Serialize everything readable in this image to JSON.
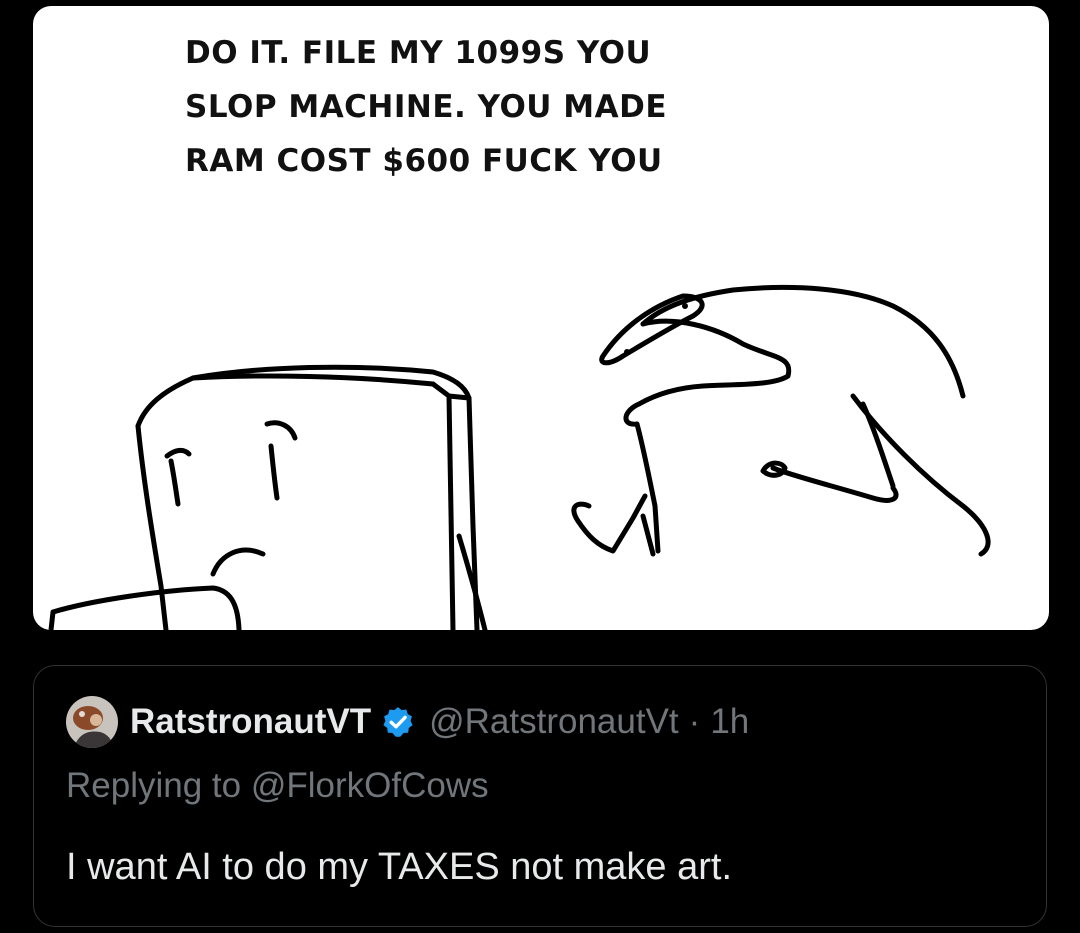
{
  "comic": {
    "caption_lines": [
      "DO IT. FILE MY 1099S YOU",
      "SLOP MACHINE. YOU MADE",
      "RAM COST $600 FUCK YOU"
    ]
  },
  "quoted_tweet": {
    "display_name": "RatstronautVT",
    "handle": "@RatstronautVt",
    "separator": "·",
    "time": "1h",
    "replying_prefix": "Replying to",
    "replying_to": "@FlorkOfCows",
    "text": "I want AI to do my TAXES not make art.",
    "verified_color": "#1d9bf0"
  },
  "colors": {
    "background": "#000000",
    "primary_text": "#e7e9ea",
    "secondary_text": "#71767b",
    "border": "#2f3336"
  }
}
